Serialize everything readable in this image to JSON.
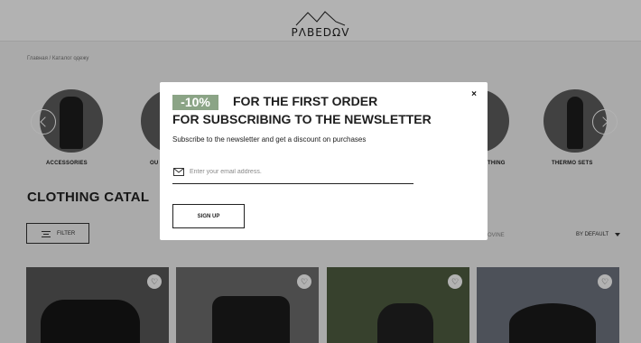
{
  "header": {
    "logo_text": "PΛBEDΩV"
  },
  "breadcrumb": {
    "items": [
      "Главная",
      "Каталог одежу"
    ],
    "separator": "/"
  },
  "categories": [
    {
      "label": "ACCESSORIES"
    },
    {
      "label": "OU"
    },
    {
      "label": "THING"
    },
    {
      "label": "THERMO SETS"
    }
  ],
  "catalog": {
    "title": "CLOTHING CATAL",
    "filter_label": "FILTER",
    "sort_partial": "OVINE",
    "sort_label": "BY DEFAULT"
  },
  "modal": {
    "promo_badge": "-10%",
    "heading_line1": "FOR THE FIRST ORDER",
    "heading_line2": "FOR SUBSCRIBING TO THE NEWSLETTER",
    "subtitle": "Subscribe to the newsletter and get a discount on purchases",
    "email_placeholder": "Enter your email address.",
    "signup_label": "SIGN UP",
    "close_symbol": "×"
  },
  "colors": {
    "promo_green": "#8ba486",
    "overlay": "rgba(0,0,0,0.30)",
    "text_dark": "#1f1f1f"
  },
  "icons": {
    "mail": "mail-icon",
    "filter": "filter-icon",
    "heart": "heart-icon",
    "close": "close-icon"
  }
}
